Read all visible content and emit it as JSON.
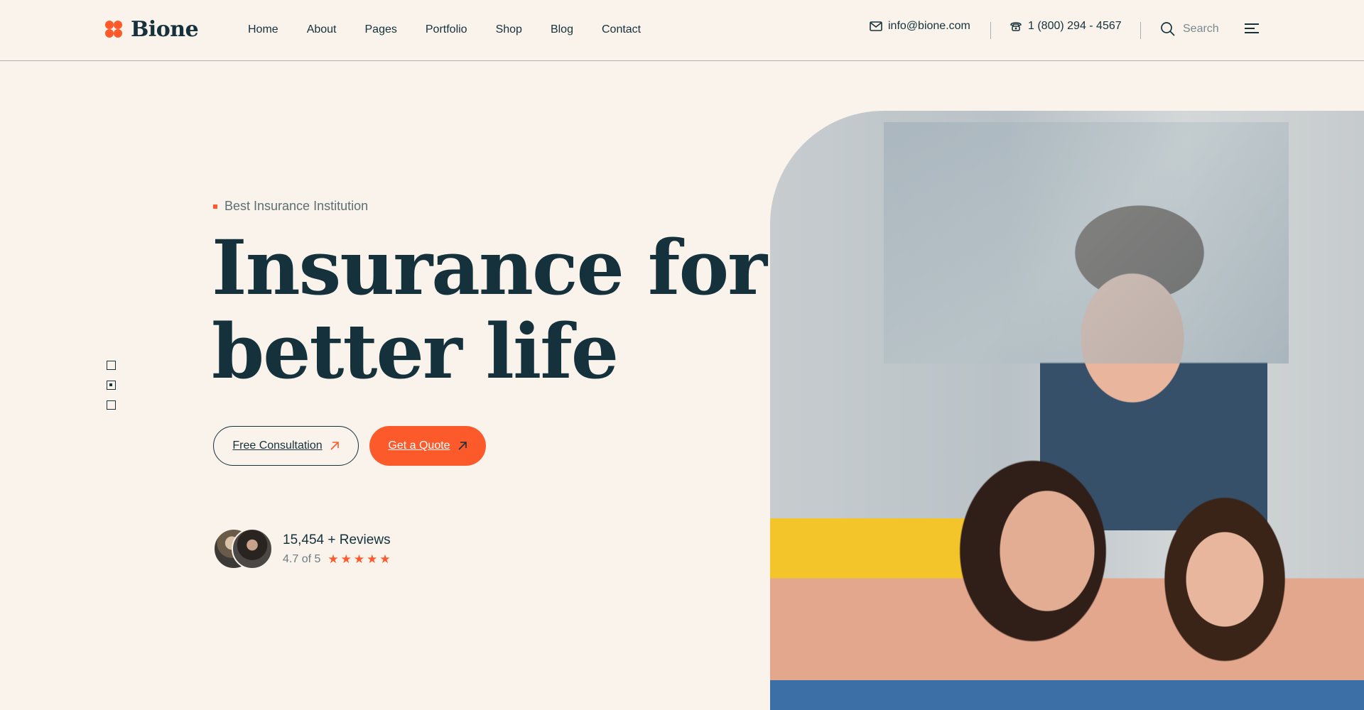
{
  "brand": {
    "name": "Bione",
    "accent": "#fd5a2c",
    "dark": "#15313b",
    "background": "#f9f3ec"
  },
  "nav": {
    "items": [
      "Home",
      "About",
      "Pages",
      "Portfolio",
      "Shop",
      "Blog",
      "Contact"
    ]
  },
  "contact": {
    "email": "info@bione.com",
    "email_icon": "mail-icon",
    "phone": "1 (800) 294 - 4567",
    "phone_icon": "phone-icon"
  },
  "search": {
    "label": "Search",
    "icon": "search-icon"
  },
  "menu": {
    "icon": "hamburger-menu-icon"
  },
  "hero": {
    "eyebrow": "Best Insurance Institution",
    "headline_line1": "Insurance for",
    "headline_line2": "better life",
    "buttons": {
      "consultation": "Free Consultation",
      "quote": "Get a Quote"
    },
    "slider": {
      "count": 3,
      "active_index": 1
    }
  },
  "reviews": {
    "count_text": "15,454 + Reviews",
    "rating_text": "4.7 of 5",
    "stars": 5
  }
}
